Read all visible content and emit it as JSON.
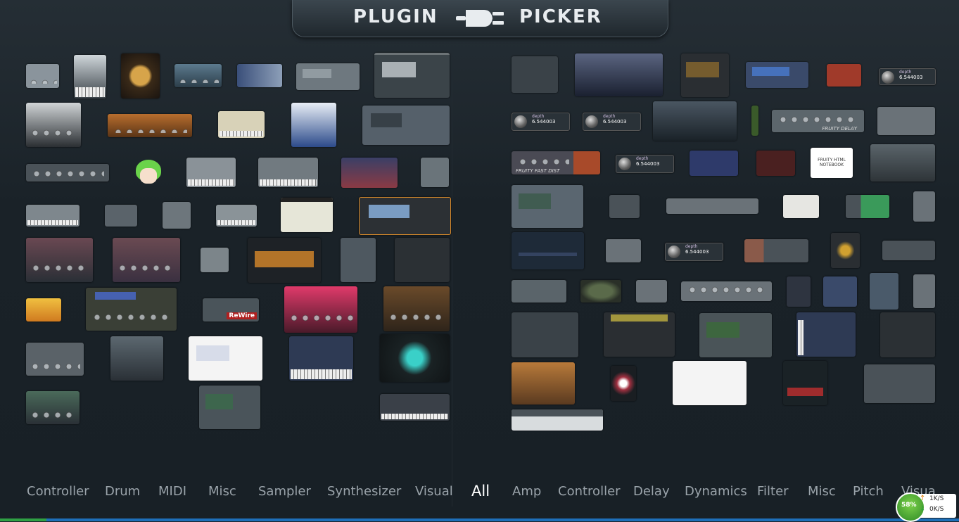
{
  "header": {
    "title_left": "PLUGIN",
    "title_right": "PICKER"
  },
  "generator_categories": [
    "Controller",
    "Drum",
    "MIDI",
    "Misc",
    "Sampler",
    "Synthesizer",
    "Visual"
  ],
  "active_tab": "All",
  "effect_categories": [
    "Amp",
    "Controller",
    "Delay",
    "Dynamics",
    "Filter",
    "Misc",
    "Pitch",
    "Visual"
  ],
  "thumbnail_text": {
    "depth_label": "depth",
    "depth_value": "6.544003",
    "fruity_fast_dist": "FRUITY FAST DIST",
    "fruity_delay": "FRUITY DELAY",
    "html_notebook": "FRUITY HTML NOTEBOOK",
    "rewire": "ReWire"
  },
  "net_widget": {
    "percent": "58%",
    "upload": "1K/S",
    "download": "0K/S"
  },
  "colors": {
    "background": "#1c242b",
    "tab_text": "#9aa3aa",
    "tab_active": "#ffffff",
    "taskbar": "#1e6fb8"
  }
}
